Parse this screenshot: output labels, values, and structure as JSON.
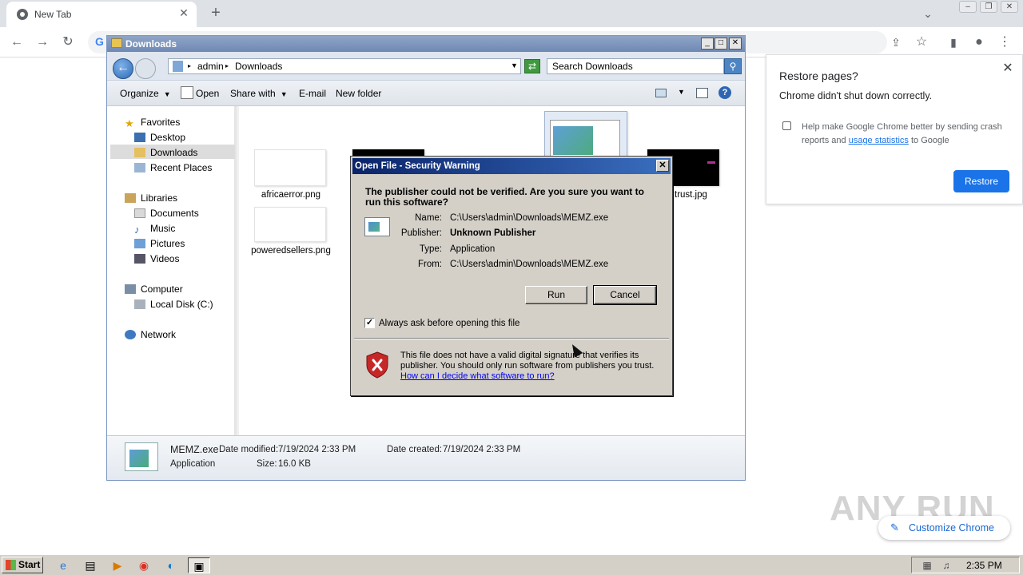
{
  "chrome": {
    "tab_title": "New Tab",
    "tab_close": "✕",
    "new_tab": "+",
    "restore_panel": {
      "title": "Restore pages?",
      "message": "Chrome didn't shut down correctly.",
      "help_text_before": "Help make Google Chrome better by sending crash reports and ",
      "help_link": "usage statistics",
      "help_text_after": " to Google",
      "restore_button": "Restore",
      "close": "✕"
    },
    "customize_button": "Customize Chrome",
    "watermark": "ANY RUN"
  },
  "explorer": {
    "title": "Downloads",
    "breadcrumb": [
      "admin",
      "Downloads"
    ],
    "search_placeholder": "Search Downloads",
    "commands": {
      "organize": "Organize",
      "open": "Open",
      "share_with": "Share with",
      "email": "E-mail",
      "new_folder": "New folder"
    },
    "nav": {
      "favorites": "Favorites",
      "desktop": "Desktop",
      "downloads": "Downloads",
      "recent_places": "Recent Places",
      "libraries": "Libraries",
      "documents": "Documents",
      "music": "Music",
      "pictures": "Pictures",
      "videos": "Videos",
      "computer": "Computer",
      "local_disk": "Local Disk (C:)",
      "network": "Network"
    },
    "files": [
      {
        "name": "africaerror.png"
      },
      {
        "name": "poweredsellers.png"
      },
      {
        "name": "trust.jpg"
      }
    ],
    "status": {
      "filename": "MEMZ.exe",
      "modified_label": "Date modified:",
      "modified_value": "7/19/2024 2:33 PM",
      "created_label": "Date created:",
      "created_value": "7/19/2024 2:33 PM",
      "type": "Application",
      "size_label": "Size:",
      "size_value": "16.0 KB"
    }
  },
  "dialog": {
    "title": "Open File - Security Warning",
    "question": "The publisher could not be verified.  Are you sure you want to run this software?",
    "fields": [
      {
        "label": "Name:",
        "value": "C:\\Users\\admin\\Downloads\\MEMZ.exe"
      },
      {
        "label": "Publisher:",
        "value": "Unknown Publisher"
      },
      {
        "label": "Type:",
        "value": "Application"
      },
      {
        "label": "From:",
        "value": "C:\\Users\\admin\\Downloads\\MEMZ.exe"
      }
    ],
    "run_button": "Run",
    "cancel_button": "Cancel",
    "checkbox_label": "Always ask before opening this file",
    "checkbox_checked": true,
    "warning": "This file does not have a valid digital signature that verifies its publisher.  You should only run software from publishers you trust.",
    "help_link": "How can I decide what software to run?"
  },
  "taskbar": {
    "start": "Start",
    "clock": "2:35 PM"
  },
  "colors": {
    "chrome_blue": "#1a73e8",
    "dialog_title": "#0a246a",
    "classic_face": "#d4d0c8"
  }
}
